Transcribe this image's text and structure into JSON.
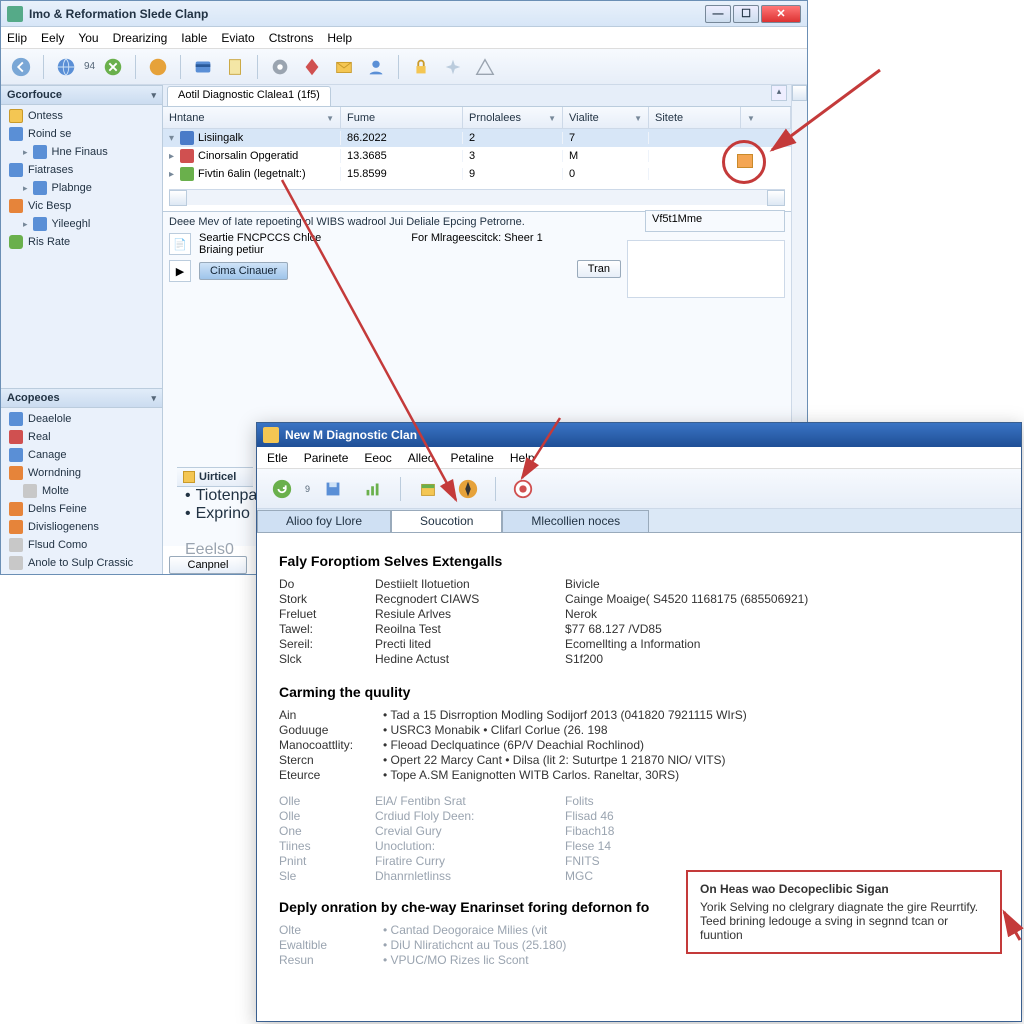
{
  "win1": {
    "title": "Imo & Reformation Slede Clanp",
    "menus": [
      "Elip",
      "Eely",
      "You",
      "Drearizing",
      "Iable",
      "Eviato",
      "Ctstrons",
      "Help"
    ],
    "left_top_header": "Gcorfouce",
    "nav_top": [
      {
        "label": "Ontess",
        "ic": "folder"
      },
      {
        "label": "Roind se",
        "ic": "blue"
      },
      {
        "label": "Hne Finaus",
        "ic": "blue",
        "indent": true
      },
      {
        "label": "Fiatrases",
        "ic": "blue"
      },
      {
        "label": "Plabnge",
        "ic": "blue",
        "indent": true
      },
      {
        "label": "Vic Besp",
        "ic": "orange"
      },
      {
        "label": "Yileeghl",
        "ic": "blue",
        "indent": true
      },
      {
        "label": "Ris Rate",
        "ic": "green"
      }
    ],
    "left_bot_header": "Acopeoes",
    "nav_bot": [
      {
        "label": "Deaelole",
        "ic": "blue"
      },
      {
        "label": "Real",
        "ic": "red"
      },
      {
        "label": "Canage",
        "ic": "blue"
      },
      {
        "label": "Worndning",
        "ic": "orange"
      },
      {
        "label": "Molte",
        "ic": "gray",
        "indent": true
      },
      {
        "label": "Delns Feine",
        "ic": "orange"
      },
      {
        "label": "Divisliogenens",
        "ic": "orange"
      },
      {
        "label": "Flsud Como",
        "ic": "gray"
      },
      {
        "label": "Anole to Sulp Crassic",
        "ic": "gray"
      }
    ],
    "tab": "Aotil Diagnostic Clalea1  (1f5)",
    "grid": {
      "cols": [
        "Hntane",
        "Fume",
        "Prnolalees",
        "Vialite",
        "Sitete",
        ""
      ],
      "rows": [
        {
          "name": "Lisiingalk",
          "c1": "86.2022",
          "c2": "2",
          "c3": "7",
          "c4": "",
          "sel": true,
          "open": true
        },
        {
          "name": "Cinorsalin Opgeratid",
          "c1": "13.3685",
          "c2": "3",
          "c3": "M",
          "c4": ""
        },
        {
          "name": "Fivtin 6alin (legetnalt:)",
          "c1": "15.8599",
          "c2": "9",
          "c3": "0",
          "c4": ""
        }
      ]
    },
    "lower": {
      "desc": "Deee Mev of I​ate repoeting ol WIBS wadrool Jui Deliale Epcing Petrorne.",
      "l1a": "Seartie FNCPCCS Chlce",
      "l1b": "For Mlrageescitck: Sheer 1",
      "l2": "Briaing petiur",
      "btn_cmd": "Cima Cinauer",
      "btn_tran": "Tran",
      "tabmini": "Vf5t1Mme",
      "cancel": "Canpnel"
    },
    "bottom_panel": {
      "hdr": "Uirticel",
      "items": [
        "Tiotenpanri",
        "Exprino"
      ],
      "footer": "Eeels0"
    }
  },
  "win2": {
    "title": "New M Diagnostic Clan",
    "menus": [
      "Etle",
      "Parinete",
      "Eeoc",
      "Alleo",
      "Petaline",
      "Help"
    ],
    "tabs": [
      "Alioo foy Llore",
      "Soucotion",
      "Mlecollien noces"
    ],
    "section1": {
      "heading": "Faly Foroptiom Selves Extengalls",
      "rows": [
        [
          "Do",
          "Destiielt Ilotuetion",
          "Bivicle"
        ],
        [
          "Stork",
          "Recgnodert CIAWS",
          "Cainge Moaige( S4520 1168175 (685506921)"
        ],
        [
          "Freluet",
          "Resiule Arlves",
          "Nerok"
        ],
        [
          "Tawel:",
          "Reoilna Test",
          "$77 68.127 /VD85"
        ],
        [
          "Sereil:",
          "Precti lited",
          "Ecomellting a Information"
        ],
        [
          "Slck",
          "Hedine Actust",
          "S1f200"
        ]
      ]
    },
    "section2": {
      "heading": "Carming the quulity",
      "rows": [
        [
          "Ain",
          "• Tad a 15 Disrroption Modling Sodijorf 2013 (041820 7921115 WIrS)"
        ],
        [
          "Goduuge",
          "• USRC3 Monabik • Clifarl Corlue (26. 198"
        ],
        [
          "Manocoattlity:",
          "• Fleoad Declquatince (6P/V Deachial Rochlinod)"
        ],
        [
          "Stercn",
          "• Opert 22 Marcy Cant • Dilsa (lit 2: Suturtpe 1 21870 NlO/ VITS)"
        ],
        [
          "Eteurce",
          "• Tope A.SM Eanignotten WITB Carlos. Raneltar, 30RS)"
        ]
      ],
      "faded": [
        [
          "Olle",
          "ElA/ Fentibn Srat",
          "Folits"
        ],
        [
          "Olle",
          "Crdiud Floly Deen:",
          "Flisad 46"
        ],
        [
          "One",
          "Crevial Gury",
          "Fibach18"
        ],
        [
          "Tiines",
          "Unoclution:",
          "Flese 14"
        ],
        [
          "Pnint",
          "Firatire Curry",
          "FNITS"
        ],
        [
          "Sle",
          "Dhanrnletlinss",
          "MGC"
        ]
      ]
    },
    "section3": {
      "heading": "Deply onration by che-way Enarinset foring defornon fo",
      "faded": [
        [
          "Olte",
          "• Cantad Deogoraice Milies (vit"
        ],
        [
          "Ewaltible",
          "• DiU Nliratichcnt au Tous (25.180)"
        ],
        [
          "Resun",
          "• VPUC/MO Rizes lic Scont"
        ]
      ]
    }
  },
  "callout": {
    "title": "On Heas wao Decopeclibic Sigan",
    "body": "Yorik Selving no clelgrary diagnate the gire Reurrtify. Teed brining ledouge a sving in segnnd tcan or fuuntion"
  }
}
